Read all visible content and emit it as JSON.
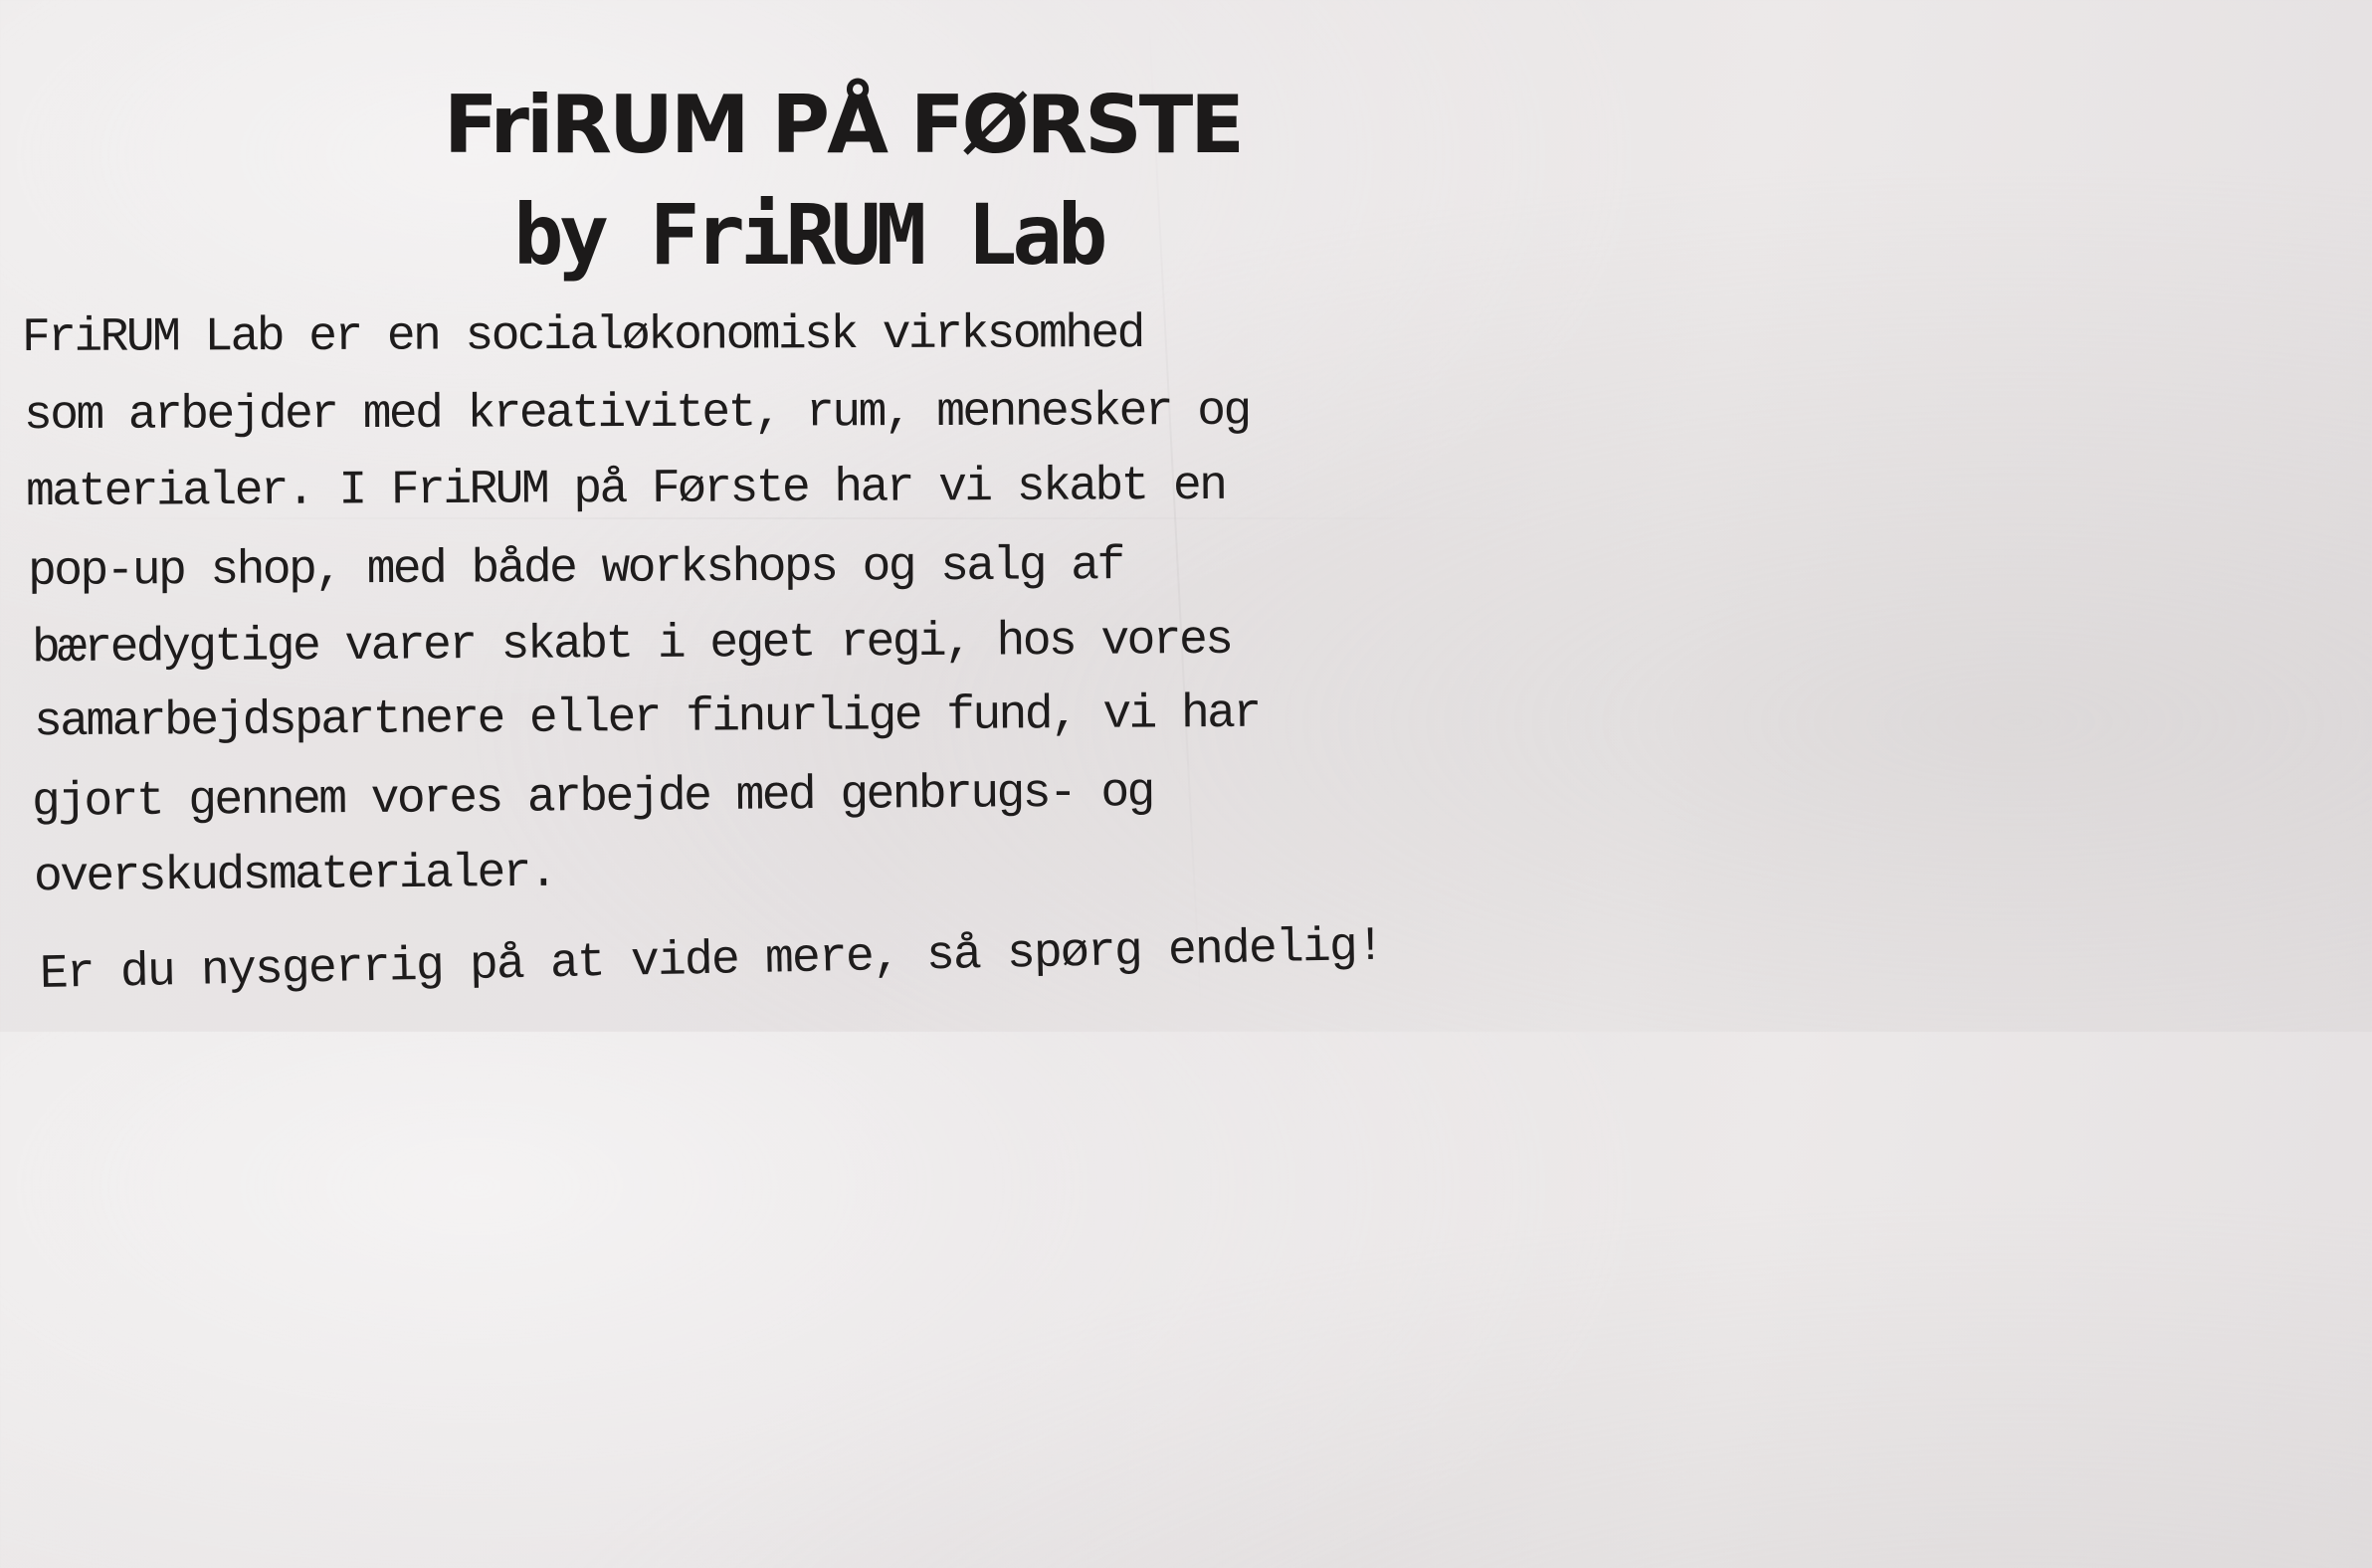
{
  "poster": {
    "title": "FriRUM PÅ FØRSTE",
    "subtitle": "by FriRUM Lab",
    "body_lines": [
      "FriRUM Lab er en socialøkonomisk virksomhed",
      "som arbejder med kreativitet, rum, mennesker og",
      "materialer. I FriRUM på Første har vi skabt en",
      "pop-up shop, med både workshops og salg af",
      "bæredygtige varer skabt i eget regi, hos vores",
      "samarbejdspartnere eller finurlige fund, vi har",
      "gjort gennem vores arbejde med genbrugs- og",
      "overskudsmaterialer."
    ],
    "closing": "Er du nysgerrig på at vide  mere, så spørg endelig!",
    "colors": {
      "paper": "#e9e6e6",
      "ink": "#1c1a1a"
    }
  }
}
